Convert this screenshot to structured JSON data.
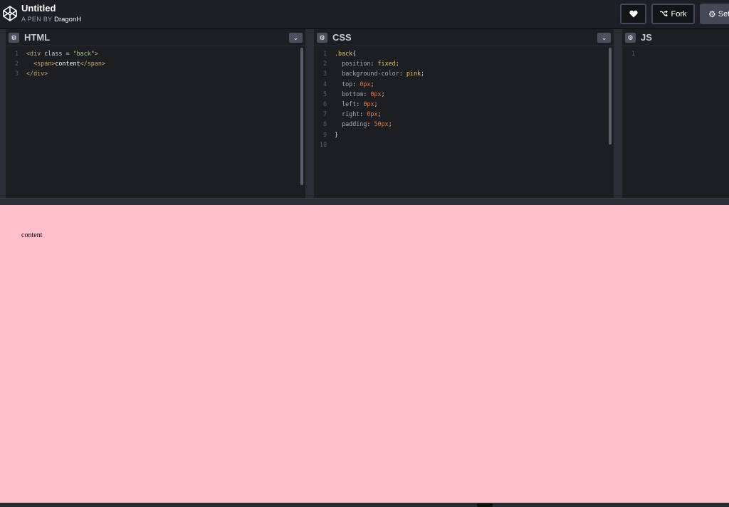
{
  "header": {
    "title": "Untitled",
    "by_label": "A PEN BY",
    "author": "DragonH",
    "fork_label": "Fork",
    "settings_label": "Set"
  },
  "icons": [
    "codepen-logo-icon",
    "heart-icon",
    "fork-icon",
    "gear-icon",
    "chevron-down-icon"
  ],
  "editors": {
    "html": {
      "title": "HTML",
      "lines": [
        {
          "n": "1",
          "parts": [
            [
              "t-tag",
              "<div "
            ],
            [
              "t-attr",
              "class"
            ],
            [
              "t-punc",
              " = "
            ],
            [
              "t-str",
              "\"back\""
            ],
            [
              "t-tag",
              ">"
            ]
          ]
        },
        {
          "n": "2",
          "parts": [
            [
              "t-tag",
              "  <span>"
            ],
            [
              "t-plain",
              "content"
            ],
            [
              "t-tag",
              "</span>"
            ]
          ]
        },
        {
          "n": "3",
          "parts": [
            [
              "t-tag",
              "</div>"
            ]
          ]
        }
      ]
    },
    "css": {
      "title": "CSS",
      "lines": [
        {
          "n": "1",
          "parts": [
            [
              "t-sel",
              ".back"
            ],
            [
              "t-punc",
              "{"
            ]
          ]
        },
        {
          "n": "2",
          "parts": [
            [
              "t-prop",
              "  position"
            ],
            [
              "t-punc",
              ": "
            ],
            [
              "t-val",
              "fixed"
            ],
            [
              "t-punc",
              ";"
            ]
          ]
        },
        {
          "n": "3",
          "parts": [
            [
              "t-prop",
              "  background-color"
            ],
            [
              "t-punc",
              ": "
            ],
            [
              "t-val",
              "pink"
            ],
            [
              "t-punc",
              ";"
            ]
          ]
        },
        {
          "n": "4",
          "parts": [
            [
              "t-prop",
              "  top"
            ],
            [
              "t-punc",
              ": "
            ],
            [
              "t-num",
              "0px"
            ],
            [
              "t-punc",
              ";"
            ]
          ]
        },
        {
          "n": "5",
          "parts": [
            [
              "t-prop",
              "  bottom"
            ],
            [
              "t-punc",
              ": "
            ],
            [
              "t-num",
              "0px"
            ],
            [
              "t-punc",
              ";"
            ]
          ]
        },
        {
          "n": "6",
          "parts": [
            [
              "t-prop",
              "  left"
            ],
            [
              "t-punc",
              ": "
            ],
            [
              "t-num",
              "0px"
            ],
            [
              "t-punc",
              ";"
            ]
          ]
        },
        {
          "n": "7",
          "parts": [
            [
              "t-prop",
              "  right"
            ],
            [
              "t-punc",
              ": "
            ],
            [
              "t-num",
              "0px"
            ],
            [
              "t-punc",
              ";"
            ]
          ]
        },
        {
          "n": "8",
          "parts": [
            [
              "t-prop",
              "  padding"
            ],
            [
              "t-punc",
              ": "
            ],
            [
              "t-num",
              "50px"
            ],
            [
              "t-punc",
              ";"
            ]
          ]
        },
        {
          "n": "9",
          "parts": [
            [
              "t-punc",
              "}"
            ]
          ]
        },
        {
          "n": "10",
          "parts": []
        }
      ]
    },
    "js": {
      "title": "JS",
      "lines": [
        {
          "n": "1",
          "parts": []
        }
      ]
    }
  },
  "preview": {
    "text": "content",
    "background_color": "#ffc0cb"
  }
}
